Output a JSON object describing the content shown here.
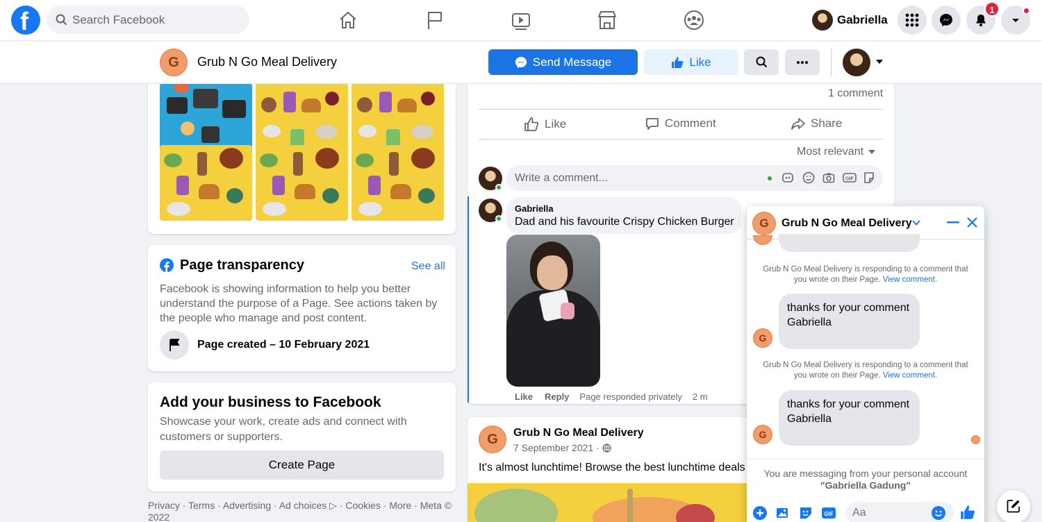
{
  "topnav": {
    "logo_letter": "f",
    "search_placeholder": "Search Facebook",
    "profile_name": "Gabriella",
    "notification_count": "1",
    "icons": [
      "home-icon",
      "flag-icon",
      "video-icon",
      "marketplace-icon",
      "groups-icon",
      "menu-grid-icon",
      "messenger-icon",
      "bell-icon",
      "caret-down-icon"
    ]
  },
  "page_header": {
    "avatar_letter": "G",
    "page_name": "Grub N Go Meal Delivery",
    "send_message_label": "Send Message",
    "like_label": "Like"
  },
  "transparency": {
    "title": "Page transparency",
    "see_all": "See all",
    "body": "Facebook is showing information to help you better understand the purpose of a Page. See actions taken by the people who manage and post content.",
    "created": "Page created – 10 February 2021"
  },
  "add_business": {
    "title": "Add your business to Facebook",
    "body": "Showcase your work, create ads and connect with customers or supporters.",
    "button": "Create Page"
  },
  "footer": {
    "text": "Privacy · Terms · Advertising · Ad choices ▷ · Cookies · More · Meta © 2022"
  },
  "post1": {
    "comment_count": "1 comment",
    "actions": {
      "like": "Like",
      "comment": "Comment",
      "share": "Share"
    },
    "sort_label": "Most relevant",
    "write_placeholder": "Write a comment...",
    "comment": {
      "author": "Gabriella",
      "text": "Dad and his favourite Crispy Chicken Burger",
      "meta_like": "Like",
      "meta_reply": "Reply",
      "meta_note": "Page responded privately",
      "meta_time": "2 m"
    }
  },
  "post2": {
    "avatar_letter": "G",
    "author": "Grub N Go Meal Delivery",
    "date": "7 September 2021 ·",
    "text": "It's almost lunchtime! Browse the best lunchtime deals"
  },
  "chat": {
    "avatar_letter": "G",
    "title": "Grub N Go Meal Delivery",
    "notes": [
      {
        "text": "Grub N Go Meal Delivery is responding to a comment that you wrote on their Page.",
        "link": "View comment."
      },
      {
        "text": "Grub N Go Meal Delivery is responding to a comment that you wrote on their Page.",
        "link": "View comment."
      }
    ],
    "messages": [
      {
        "text": "thanks for your comment Gabriella"
      },
      {
        "text": "thanks for your comment Gabriella"
      }
    ],
    "footer_note": "You are messaging from your personal account",
    "footer_account": "\"Gabriella Gadung\"",
    "input_placeholder": "Aa"
  },
  "colors": {
    "brand_blue": "#1877f2",
    "page_bg": "#f0f2f5",
    "avatar_orange": "#f29c6b",
    "badge_red": "#e41e3f"
  }
}
